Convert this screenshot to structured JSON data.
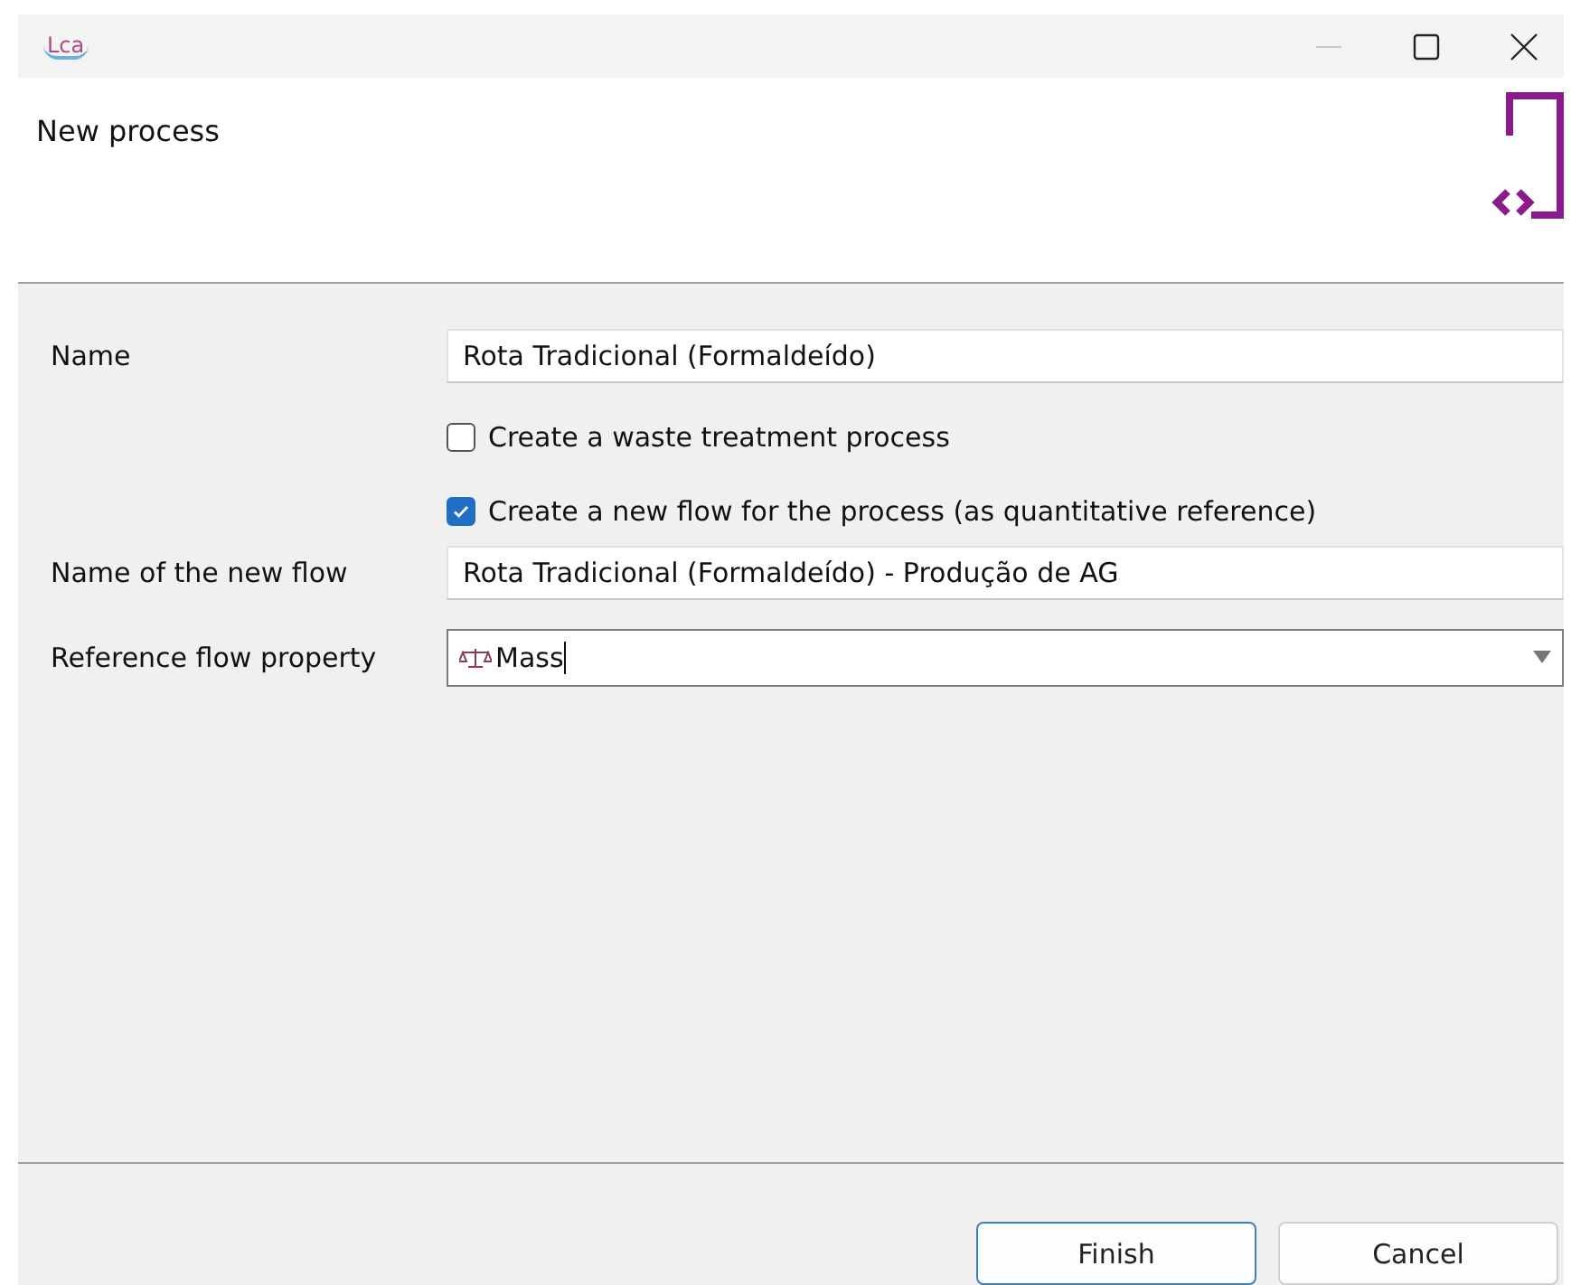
{
  "window": {
    "logo": "Lca"
  },
  "header": {
    "title": "New process"
  },
  "form": {
    "fields": [
      {
        "kind": "text",
        "label": "Name",
        "value": "Rota Tradicional (Formaldeído)"
      },
      {
        "kind": "checkbox",
        "label": "Create a waste treatment process",
        "checked": false
      },
      {
        "kind": "checkbox",
        "label": "Create a new flow for the process (as quantitative reference)",
        "checked": true
      },
      {
        "kind": "text",
        "label": "Name of the new flow",
        "value": "Rota Tradicional (Formaldeído) - Produção de AG"
      },
      {
        "kind": "combo",
        "label": "Reference flow property",
        "value": "Mass"
      }
    ]
  },
  "buttons": [
    {
      "label": "Finish",
      "default": true
    },
    {
      "label": "Cancel",
      "default": false
    }
  ]
}
